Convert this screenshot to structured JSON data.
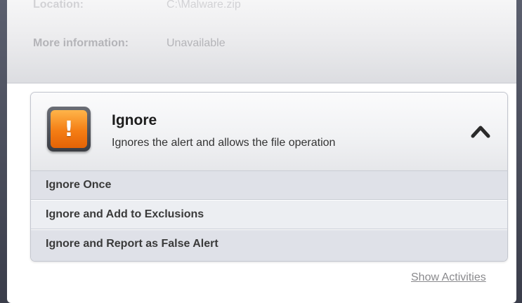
{
  "details": {
    "location_label": "Location:",
    "location_value": "C:\\Malware.zip",
    "info_label": "More information:",
    "info_value": "Unavailable"
  },
  "option": {
    "icon": "warning-exclamation-icon",
    "title": "Ignore",
    "description": "Ignores the alert and allows the file operation",
    "collapse_icon": "chevron-up-icon",
    "sub_options": [
      "Ignore Once",
      "Ignore and Add to Exclusions",
      "Ignore and Report as False Alert"
    ]
  },
  "footer": {
    "show_activities": "Show Activities"
  }
}
